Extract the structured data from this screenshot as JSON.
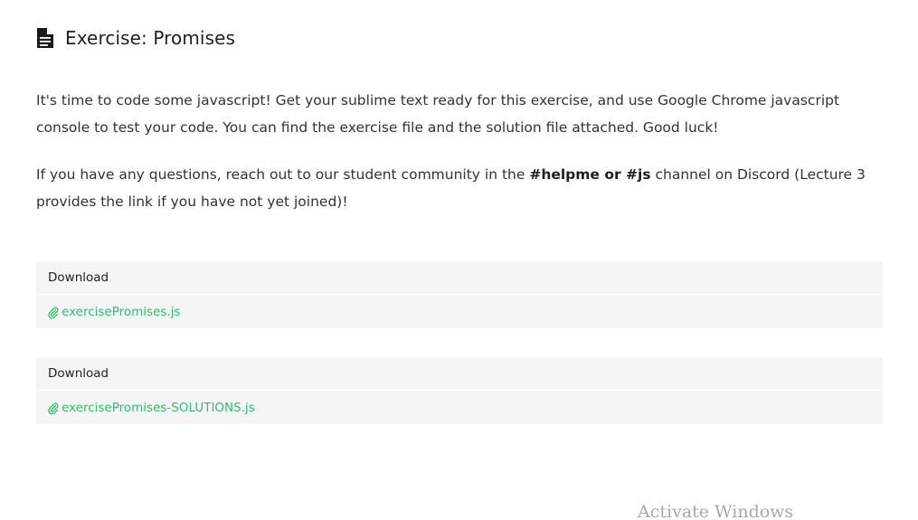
{
  "header": {
    "icon": "document-icon",
    "title": "Exercise: Promises"
  },
  "content": {
    "paragraph_1": "It's time to code some javascript! Get your sublime text ready for this exercise, and use Google Chrome javascript console to test your code. You can find the exercise file and the solution file attached. Good luck!",
    "paragraph_2_before": "If you have any questions, reach out to our student community in the ",
    "paragraph_2_bold": "#helpme or #js",
    "paragraph_2_after": " channel on Discord (Lecture 3 provides the link if you have not yet joined)!"
  },
  "downloads": [
    {
      "heading": "Download",
      "icon": "paperclip-icon",
      "filename": "exercisePromises.js"
    },
    {
      "heading": "Download",
      "icon": "paperclip-icon",
      "filename": "exercisePromises-SOLUTIONS.js"
    }
  ],
  "watermark": {
    "text": "Activate Windows"
  },
  "colors": {
    "link": "#2dc26b",
    "box_background": "#f5f5f5",
    "text": "#333333"
  }
}
